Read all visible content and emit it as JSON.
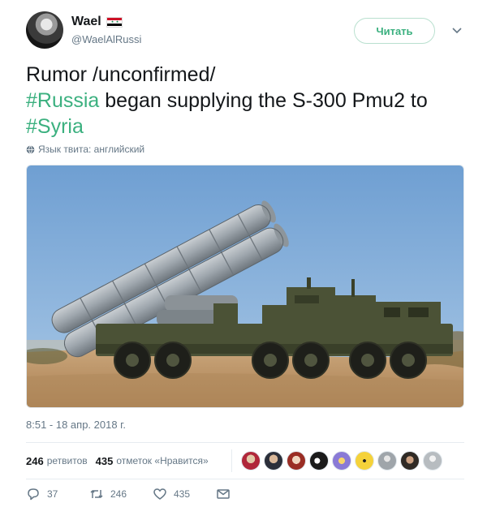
{
  "author": {
    "name": "Wael",
    "handle": "@WaelAlRussi"
  },
  "follow_button": {
    "label": "Читать"
  },
  "tweet": {
    "line1": "Rumor /unconfirmed/",
    "hashtag1": "#Russia",
    "line2_rest": " began supplying the S-300 Pmu2 to",
    "hashtag2": "#Syria",
    "language_note": "Язык твита: английский",
    "timestamp": "8:51 - 18 апр. 2018 г."
  },
  "stats": {
    "retweets_count": "246",
    "retweets_label": "ретвитов",
    "likes_count": "435",
    "likes_label": "отметок «Нравится»"
  },
  "actions": {
    "reply_count": "37",
    "retweet_count": "246",
    "like_count": "435"
  },
  "colors": {
    "accent": "#3bb07f",
    "muted": "#657786",
    "text": "#14171a"
  },
  "icons": [
    "chevron-down-icon",
    "globe-icon",
    "reply-icon",
    "retweet-icon",
    "heart-icon",
    "direct-message-icon"
  ]
}
